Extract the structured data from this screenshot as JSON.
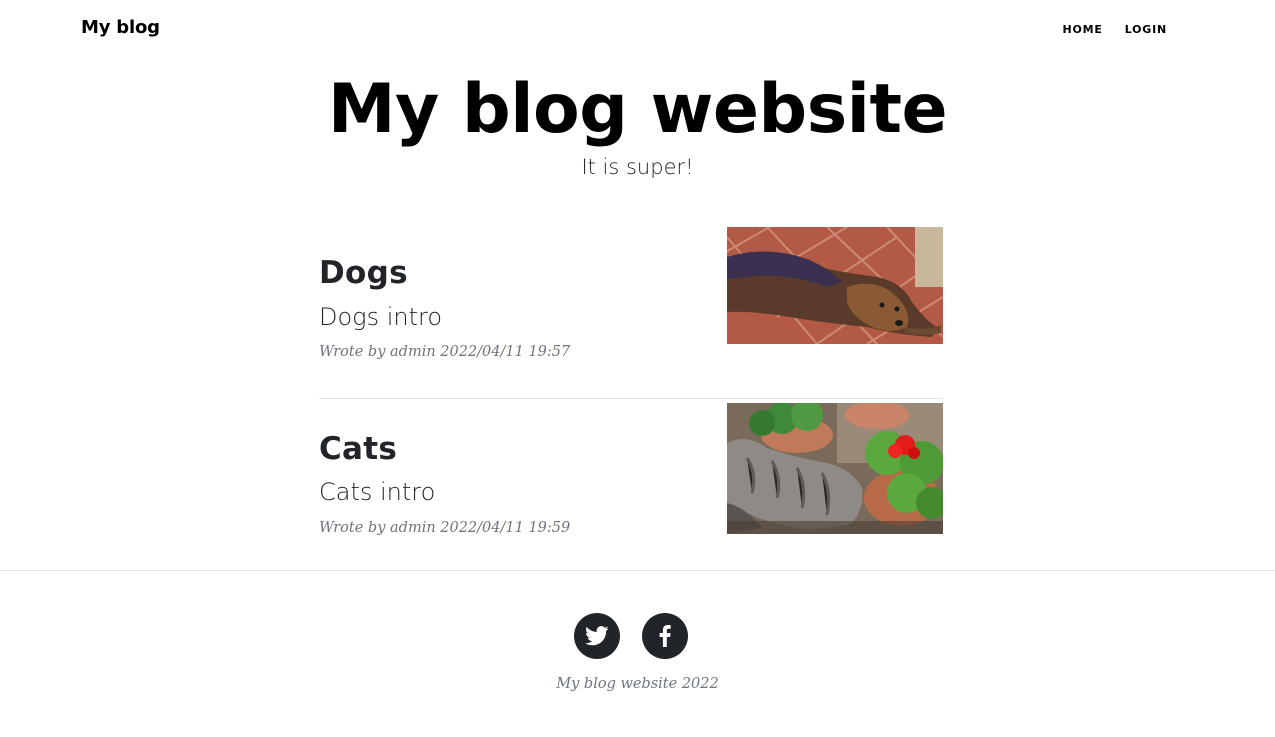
{
  "navbar": {
    "brand": "My blog",
    "links": [
      {
        "label": "HOME"
      },
      {
        "label": "LOGIN"
      }
    ]
  },
  "hero": {
    "title": "My blog website",
    "subtitle": "It is super!"
  },
  "posts": [
    {
      "title": "Dogs",
      "intro": "Dogs intro",
      "meta": "Wrote by admin 2022/04/11 19:57",
      "thumbnail": "dog-photo"
    },
    {
      "title": "Cats",
      "intro": "Cats intro",
      "meta": "Wrote by admin 2022/04/11 19:59",
      "thumbnail": "cat-with-flowers-photo"
    }
  ],
  "footer": {
    "social": [
      {
        "icon": "twitter-icon"
      },
      {
        "icon": "facebook-icon"
      }
    ],
    "copyright": "My blog website 2022"
  },
  "colors": {
    "text": "#212529",
    "muted": "#6c757d",
    "rule": "#dee2e6",
    "social_bg": "#212529"
  }
}
